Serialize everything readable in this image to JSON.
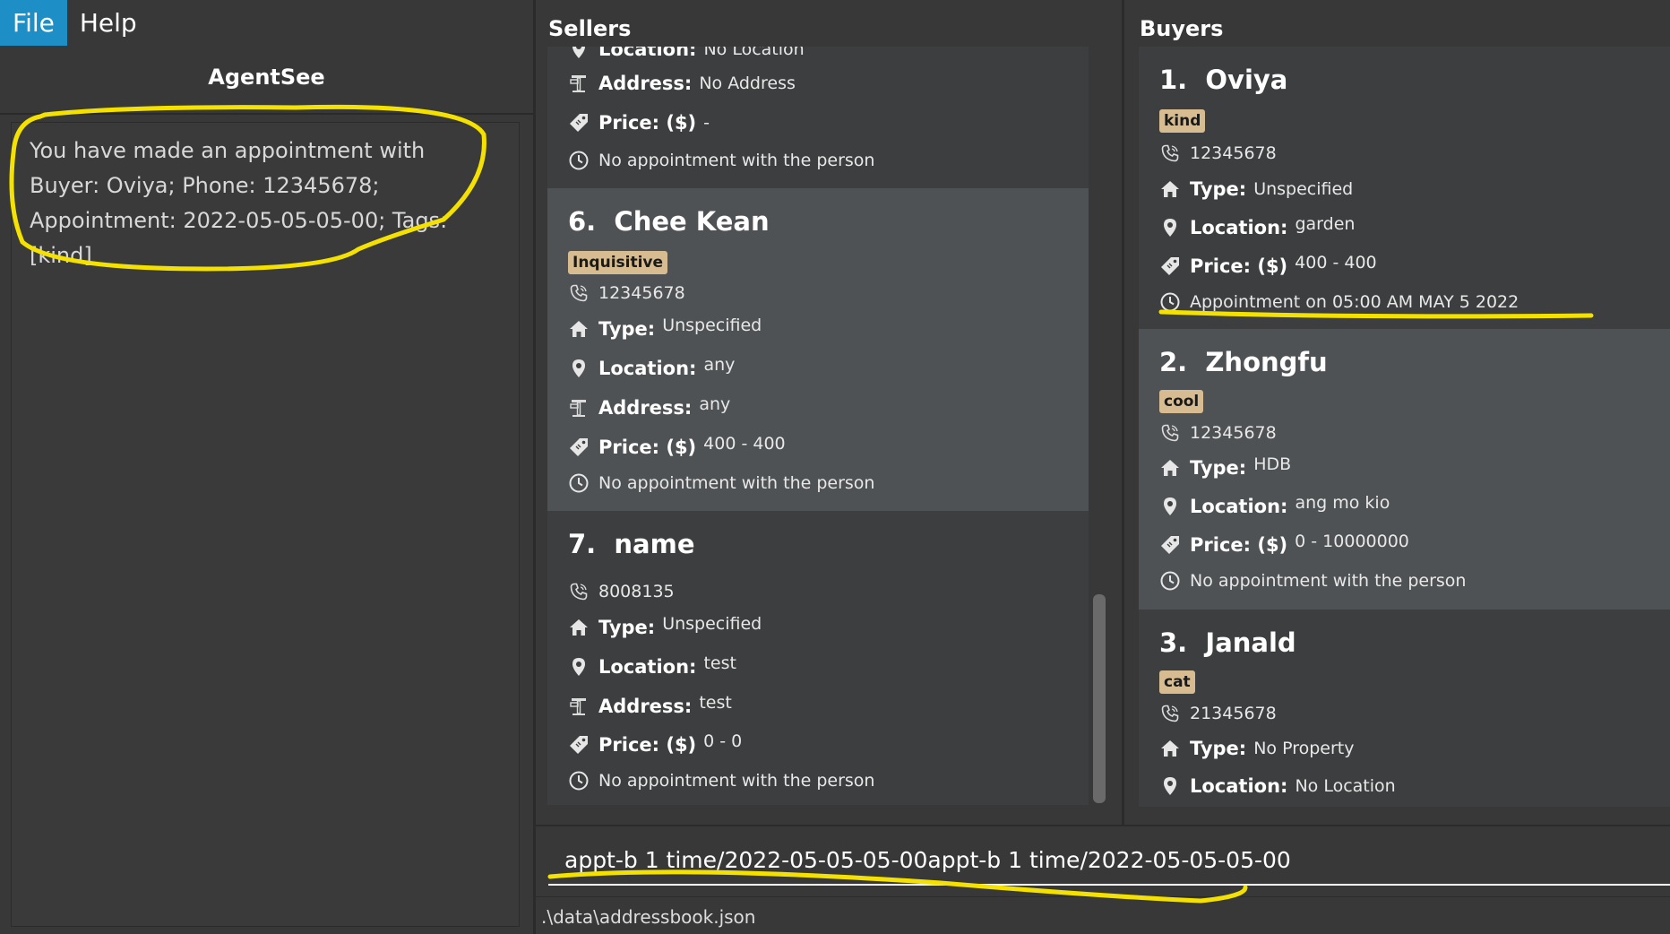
{
  "menu": {
    "file": "File",
    "help": "Help"
  },
  "app_title": "AgentSee",
  "result_message": "You have made an appointment with Buyer: Oviya; Phone: 12345678; Appointment: 2022-05-05-05-00; Tags: [kind]",
  "sellers": {
    "title": "Sellers",
    "partial_card": {
      "location_label": "Location:",
      "location_value": "No Location",
      "address_label": "Address:",
      "address_value": "No Address",
      "price_label": "Price: ($)",
      "price_value": "-",
      "appointment": "No appointment with the person"
    },
    "cards": [
      {
        "index": "6.",
        "name": "Chee Kean",
        "tag": "Inquisitive",
        "phone": "12345678",
        "type_label": "Type:",
        "type_value": "Unspecified",
        "location_label": "Location:",
        "location_value": "any",
        "address_label": "Address:",
        "address_value": "any",
        "price_label": "Price: ($)",
        "price_value": "400 - 400",
        "appointment": "No appointment with the person"
      },
      {
        "index": "7.",
        "name": "name",
        "phone": "8008135",
        "type_label": "Type:",
        "type_value": "Unspecified",
        "location_label": "Location:",
        "location_value": "test",
        "address_label": "Address:",
        "address_value": "test",
        "price_label": "Price: ($)",
        "price_value": "0 - 0",
        "appointment": "No appointment with the person"
      }
    ]
  },
  "buyers": {
    "title": "Buyers",
    "cards": [
      {
        "index": "1.",
        "name": "Oviya",
        "tag": "kind",
        "phone": "12345678",
        "type_label": "Type:",
        "type_value": "Unspecified",
        "location_label": "Location:",
        "location_value": "garden",
        "price_label": "Price: ($)",
        "price_value": "400 - 400",
        "appointment": "Appointment on 05:00 AM MAY 5 2022"
      },
      {
        "index": "2.",
        "name": "Zhongfu",
        "tag": "cool",
        "phone": "12345678",
        "type_label": "Type:",
        "type_value": "HDB",
        "location_label": "Location:",
        "location_value": "ang mo kio",
        "price_label": "Price: ($)",
        "price_value": "0 - 10000000",
        "appointment": "No appointment with the person"
      },
      {
        "index": "3.",
        "name": "Janald",
        "tag": "cat",
        "phone": "21345678",
        "type_label": "Type:",
        "type_value": "No Property",
        "location_label": "Location:",
        "location_value": "No Location"
      }
    ]
  },
  "command": {
    "value": "appt-b 1 time/2022-05-05-05-00appt-b 1 time/2022-05-05-05-00"
  },
  "status": {
    "path": ".\\data\\addressbook.json"
  },
  "colors": {
    "accent": "#1e8fc6",
    "tag_bg": "#d6bc90",
    "highlight_card": "#4f5254",
    "annotation": "#f5e100"
  }
}
